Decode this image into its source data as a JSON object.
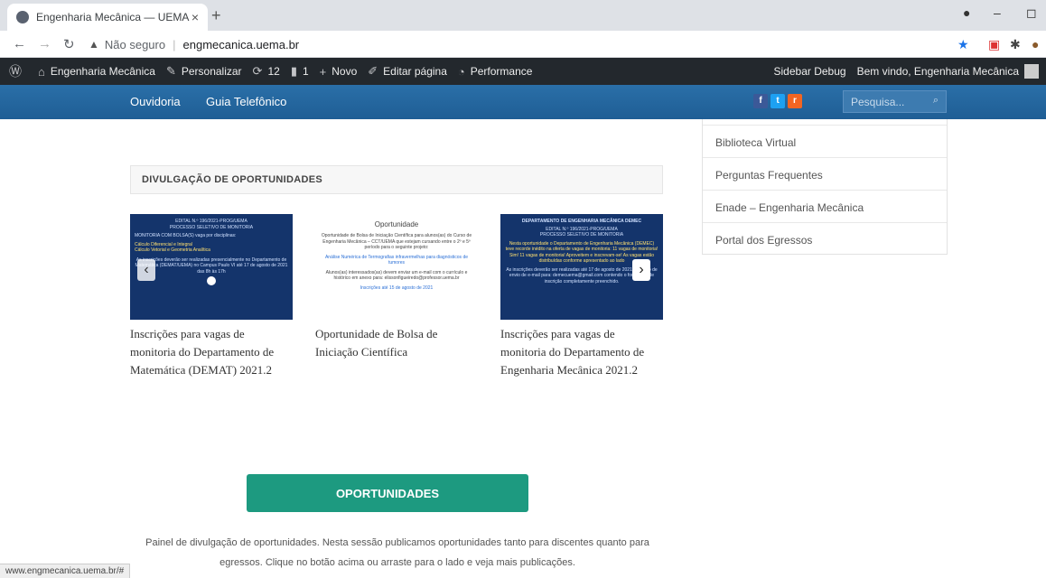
{
  "browser": {
    "tab_title": "Engenharia Mecânica — UEMA",
    "tab_close": "×",
    "new_tab": "+",
    "security_label": "Não seguro",
    "url": "engmecanica.uema.br",
    "status_url": "www.engmecanica.uema.br/#"
  },
  "wp_admin_bar": {
    "site_name": "Engenharia Mecânica",
    "customize": "Personalizar",
    "updates_count": "12",
    "comments_count": "1",
    "new": "Novo",
    "edit_page": "Editar página",
    "performance": "Performance",
    "sidebar_debug": "Sidebar Debug",
    "welcome": "Bem vindo, Engenharia Mecânica"
  },
  "site_menu": {
    "items": [
      "Ouvidoria",
      "Guia Telefônico"
    ],
    "search_placeholder": "Pesquisa..."
  },
  "social": {
    "facebook": "f",
    "twitter": "t",
    "rss": "r"
  },
  "sidebar": {
    "items": [
      "Biblioteca Virtual",
      "Perguntas Frequentes",
      "Enade – Engenharia Mecânica",
      "Portal dos Egressos"
    ]
  },
  "section": {
    "title": "DIVULGAÇÃO DE OPORTUNIDADES"
  },
  "cards": [
    {
      "thumb_lines": [
        "EDITAL N.º 196/2021-PROG/UEMA",
        "PROCESSO SELETIVO DE MONITORIA",
        "MONITORIA COM BOLSA(S) vaga por disciplinas:",
        "Cálculo Diferencial e Integral",
        "Cálculo Vetorial e Geometria Analítica",
        "As inscrições deverão ser realizadas presencialmente no Departamento de Matemática (DEMAT/UEMA) no Campus Paulo VI até 17 de agosto de 2021 das 8h às 17h"
      ],
      "caption": "Inscrições para vagas de monitoria do Departamento de Matemática (DEMAT) 2021.2"
    },
    {
      "thumb_lines": [
        "Oportunidade",
        "Oportunidade de Bolsa de Iniciação Científica para alunos(as) do Curso de Engenharia Mecânica – CCT/UEMA que estejam cursando entre o 2º e 5º período para o seguinte projeto:",
        "Análise Numérica de Termografias infravermelhas para diagnósticos de tumores",
        "Alunos(as) interessados(as) devem enviar um e-mail com o currículo e histórico em anexo para: elissonfigueiredo@professor.uema.br",
        "Inscrições até 15 de agosto de 2021"
      ],
      "caption": "Oportunidade de Bolsa de Iniciação Científica"
    },
    {
      "thumb_lines": [
        "DEPARTAMENTO DE ENGENHARIA MECÂNICA DEMEC",
        "EDITAL N.º 196/2021-PROG/UEMA",
        "PROCESSO SELETIVO DE MONITORIA",
        "Nesta oportunidade o Departamento de Engenharia Mecânica (DEMEC) teve recorde inédito na oferta de vagas de monitoria: 11 vagas de monitoria! Sim! 11 vagas de monitoria! Aproveitem e inscrevam-se! As vagas estão distribuídas conforme apresentado ao lado",
        "As inscrições deverão ser realizadas até 17 de agosto de 2021 por meio de envio de e-mail para: demecuema@gmail.com contendo o formulário de inscrição completamente preenchido."
      ],
      "caption": "Inscrições para vagas de monitoria do Departamento de Engenharia Mecânica 2021.2"
    }
  ],
  "carousel": {
    "prev": "‹",
    "next": "›"
  },
  "cta": {
    "label": "OPORTUNIDADES",
    "description": "Painel de divulgação de oportunidades. Nesta sessão publicamos oportunidades tanto para discentes quanto para egressos. Clique no botão acima ou arraste para o lado e veja mais publicações."
  },
  "colors": {
    "wp_bar": "#23282d",
    "site_bar": "#1f5e95",
    "cta": "#1d9a80",
    "facebook": "#3b5998",
    "twitter": "#1da1f2",
    "rss": "#f26522"
  }
}
